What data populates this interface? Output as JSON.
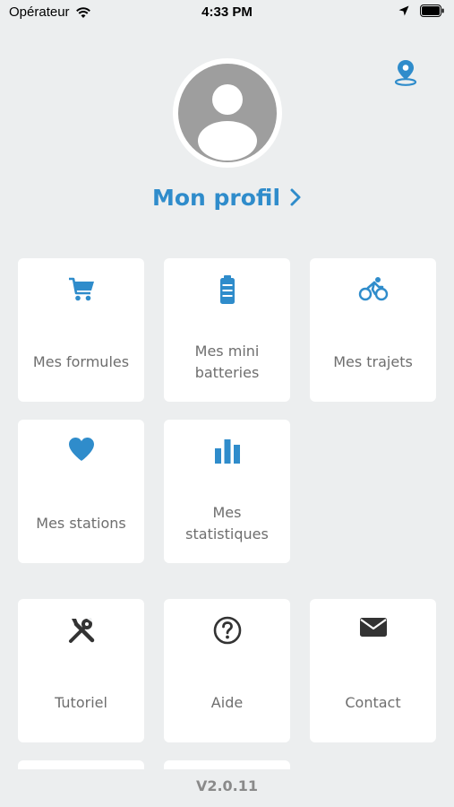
{
  "status_bar": {
    "carrier": "Opérateur",
    "time": "4:33 PM"
  },
  "header": {
    "location_icon": "map-pin-icon",
    "avatar_icon": "user-avatar-icon",
    "profile_label": "Mon profil"
  },
  "tiles": [
    {
      "label": "Mes formules",
      "icon": "cart-icon"
    },
    {
      "label": "Mes mini batteries",
      "icon": "battery-icon"
    },
    {
      "label": "Mes trajets",
      "icon": "bike-icon"
    },
    {
      "label": "Mes stations",
      "icon": "heart-icon"
    },
    {
      "label": "Mes statistiques",
      "icon": "bar-chart-icon"
    }
  ],
  "secondary_tiles": [
    {
      "label": "Tutoriel",
      "icon": "tools-icon"
    },
    {
      "label": "Aide",
      "icon": "help-circle-icon"
    },
    {
      "label": "Contact",
      "icon": "envelope-icon"
    }
  ],
  "version": "V2.0.11",
  "colors": {
    "accent": "#2f8ccb",
    "background": "#eceeef",
    "tile": "#ffffff",
    "label": "#6e6e6e",
    "dark_icon": "#333333"
  }
}
